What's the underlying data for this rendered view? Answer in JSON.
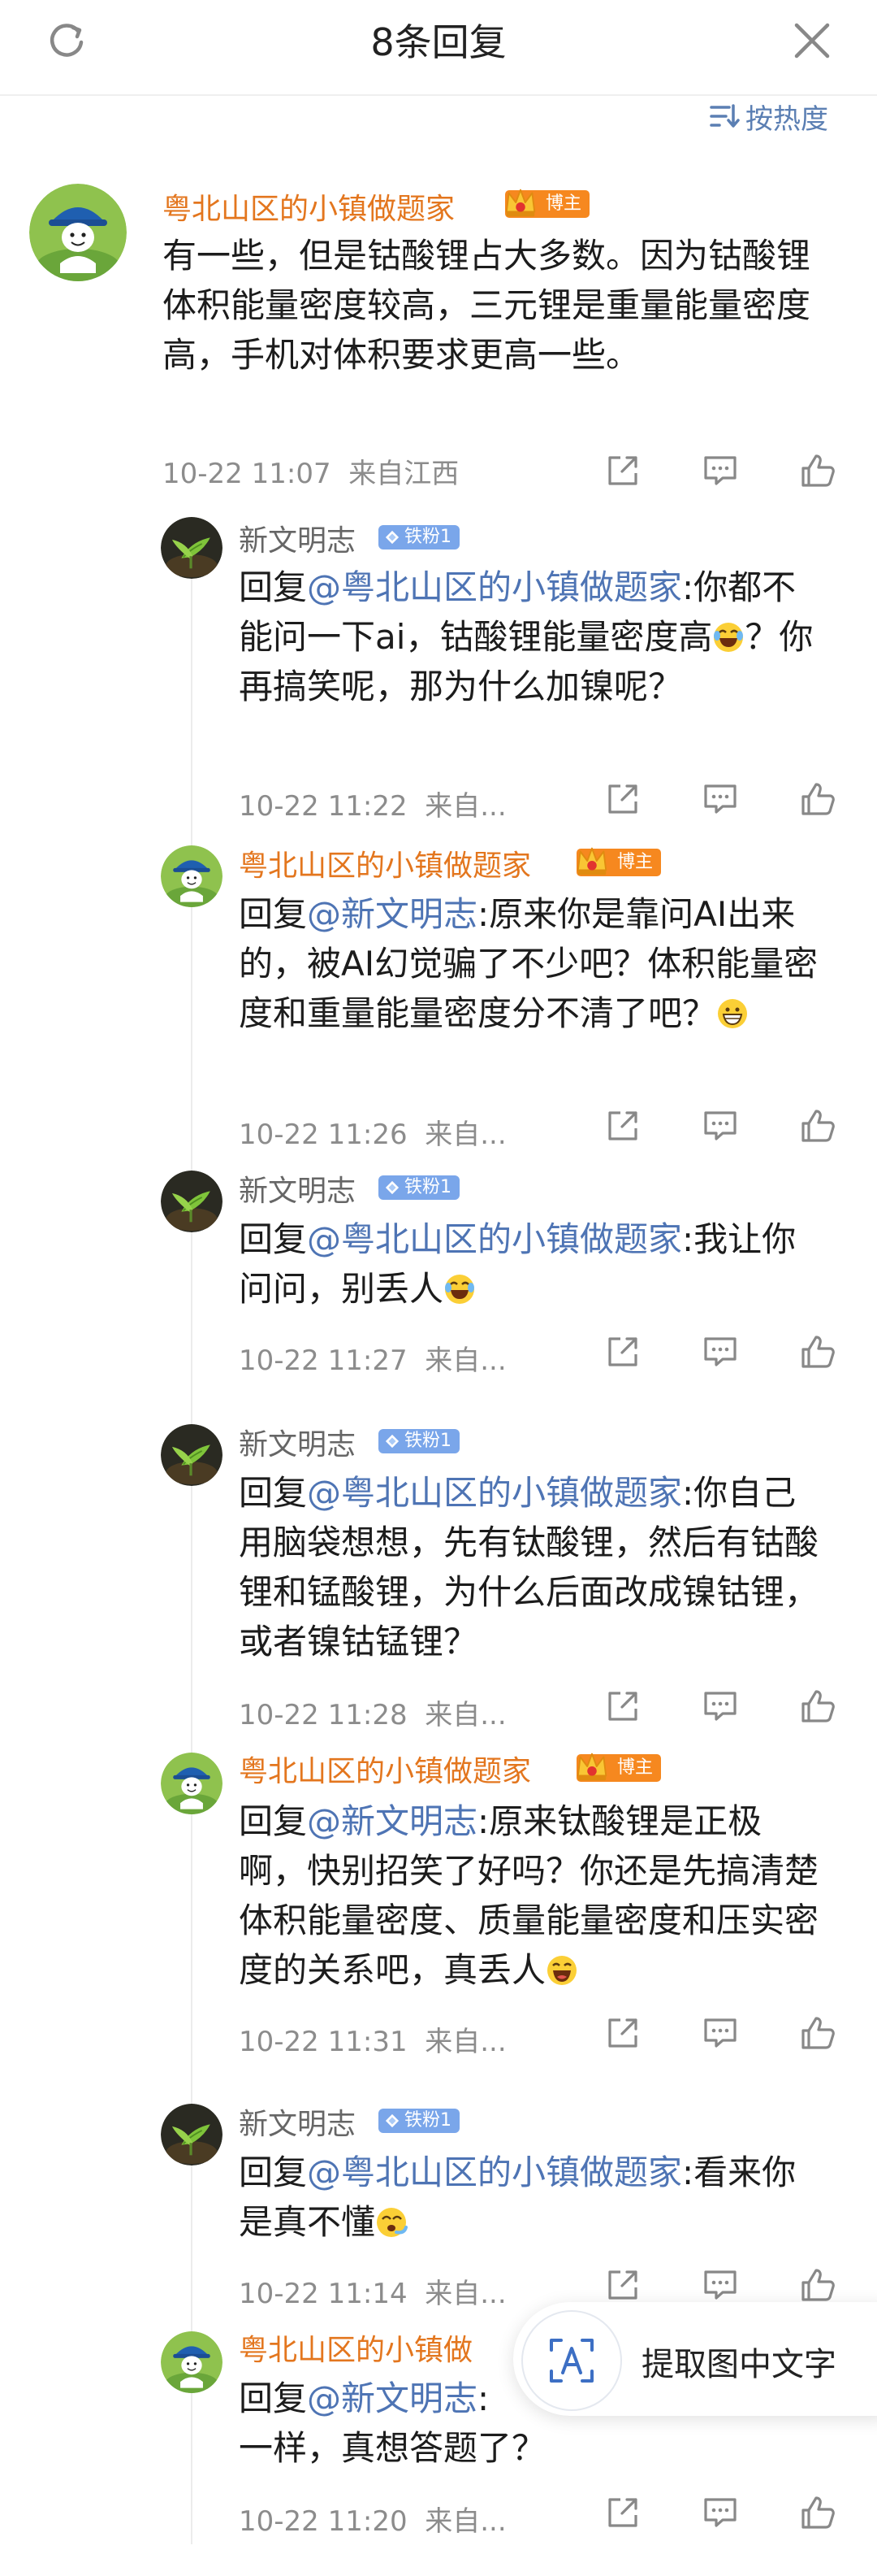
{
  "header": {
    "title": "8条回复"
  },
  "sort": {
    "label": "按热度"
  },
  "post": {
    "author": "粤北山区的小镇做题家",
    "badge": "博主",
    "text": "有一些，但是钴酸锂占大多数。因为钴酸锂体积能量密度较高，三元锂是重量能量密度高，手机对体积要求更高一些。",
    "time": "10-22 11:07",
    "location": "来自江西"
  },
  "replies": [
    {
      "author": "新文明志",
      "badge": "铁粉1",
      "prefix": "回复",
      "mention": "@粤北山区的小镇做题家",
      "text": ":你都不能问一下ai，钴酸锂能量密度高",
      "emoji": "laugh-cry",
      "text2": "？你再搞笑呢，那为什么加镍呢？",
      "time": "10-22 11:22",
      "location": "来自..."
    },
    {
      "author": "粤北山区的小镇做题家",
      "badge": "博主",
      "prefix": "回复",
      "mention": "@新文明志",
      "text": ":原来你是靠问AI出来的，被AI幻觉骗了不少吧？体积能量密度和重量能量密度分不清了吧？",
      "emoji": "grin",
      "time": "10-22 11:26",
      "location": "来自..."
    },
    {
      "author": "新文明志",
      "badge": "铁粉1",
      "prefix": "回复",
      "mention": "@粤北山区的小镇做题家",
      "text": ":我让你问问，别丢人",
      "emoji": "laugh-cry",
      "time": "10-22 11:27",
      "location": "来自..."
    },
    {
      "author": "新文明志",
      "badge": "铁粉1",
      "prefix": "回复",
      "mention": "@粤北山区的小镇做题家",
      "text": ":你自己用脑袋想想，先有钛酸锂，然后有钴酸锂和锰酸锂，为什么后面改成镍钴锂，或者镍钴锰锂？",
      "time": "10-22 11:28",
      "location": "来自..."
    },
    {
      "author": "粤北山区的小镇做题家",
      "badge": "博主",
      "prefix": "回复",
      "mention": "@新文明志",
      "text": ":原来钛酸锂是正极啊，快别招笑了好吗？你还是先搞清楚体积能量密度、质量能量密度和压实密度的关系吧，真丢人",
      "emoji": "laugh",
      "time": "10-22 11:31",
      "location": "来自..."
    },
    {
      "author": "新文明志",
      "badge": "铁粉1",
      "prefix": "回复",
      "mention": "@粤北山区的小镇做题家",
      "text": ":看来你是真不懂",
      "emoji": "dizzy",
      "time": "10-22 11:14",
      "location": "来自..."
    },
    {
      "author": "粤北山区的小镇做",
      "badge": "",
      "prefix": "回复",
      "mention": "@新文明志",
      "text": ":",
      "line2": "一样，真想答题了？",
      "time": "10-22 11:20",
      "location": "来自..."
    }
  ],
  "floating": {
    "label": "提取图中文字"
  },
  "colors": {
    "author_blogger": "#e3761e",
    "mention": "#4e74b4",
    "badge_blogger": "#f6881f",
    "badge_fan": "#7aa6ea"
  }
}
